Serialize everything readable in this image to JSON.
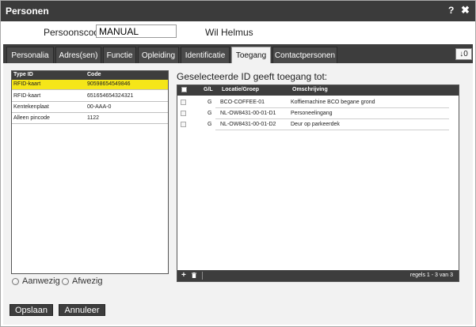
{
  "window": {
    "title": "Personen",
    "help_label": "?",
    "close_label": "✖"
  },
  "header": {
    "code_label": "Persoonscode:",
    "code_value": "MANUAL",
    "person_name": "Wil Helmus"
  },
  "tabs": [
    {
      "label": "Personalia"
    },
    {
      "label": "Adres(sen)"
    },
    {
      "label": "Functie"
    },
    {
      "label": "Opleiding"
    },
    {
      "label": "Identificatie"
    },
    {
      "label": "Toegang"
    },
    {
      "label": "Contactpersonen"
    }
  ],
  "active_tab": "Toegang",
  "tab_counter": "↓0",
  "id_list": {
    "columns": {
      "type": "Type ID",
      "code": "Code"
    },
    "rows": [
      {
        "type": "RFID-kaart",
        "code": "90598654549846"
      },
      {
        "type": "RFID-kaart",
        "code": "651654654324321"
      },
      {
        "type": "Kentekenplaat",
        "code": "00-AAA-0"
      },
      {
        "type": "Alleen pincode",
        "code": "1122"
      }
    ],
    "selected_index": 0,
    "highlight_color": "#f5e619"
  },
  "presence": {
    "present_label": "Aanwezig",
    "absent_label": "Afwezig"
  },
  "access": {
    "title": "Geselecteerde ID geeft toegang tot:",
    "columns": {
      "gl": "G/L",
      "location": "Locatie/Groep",
      "description": "Omschrijving"
    },
    "rows": [
      {
        "gl": "G",
        "location": "BCO-COFFEE-01",
        "description": "Koffiemachine BCO begane grond"
      },
      {
        "gl": "G",
        "location": "NL-OW8431-00-01-D1",
        "description": "Personeelingang"
      },
      {
        "gl": "G",
        "location": "NL-OW8431-00-01-D2",
        "description": "Deur op parkeerdek"
      }
    ],
    "add_label": "+",
    "pager": "regels 1 - 3 van 3"
  },
  "buttons": {
    "save": "Opslaan",
    "cancel": "Annuleer"
  },
  "colors": {
    "titlebar": "#3b3b3b",
    "dark": "#3d3d3d",
    "panel": "#f2f2f2"
  }
}
